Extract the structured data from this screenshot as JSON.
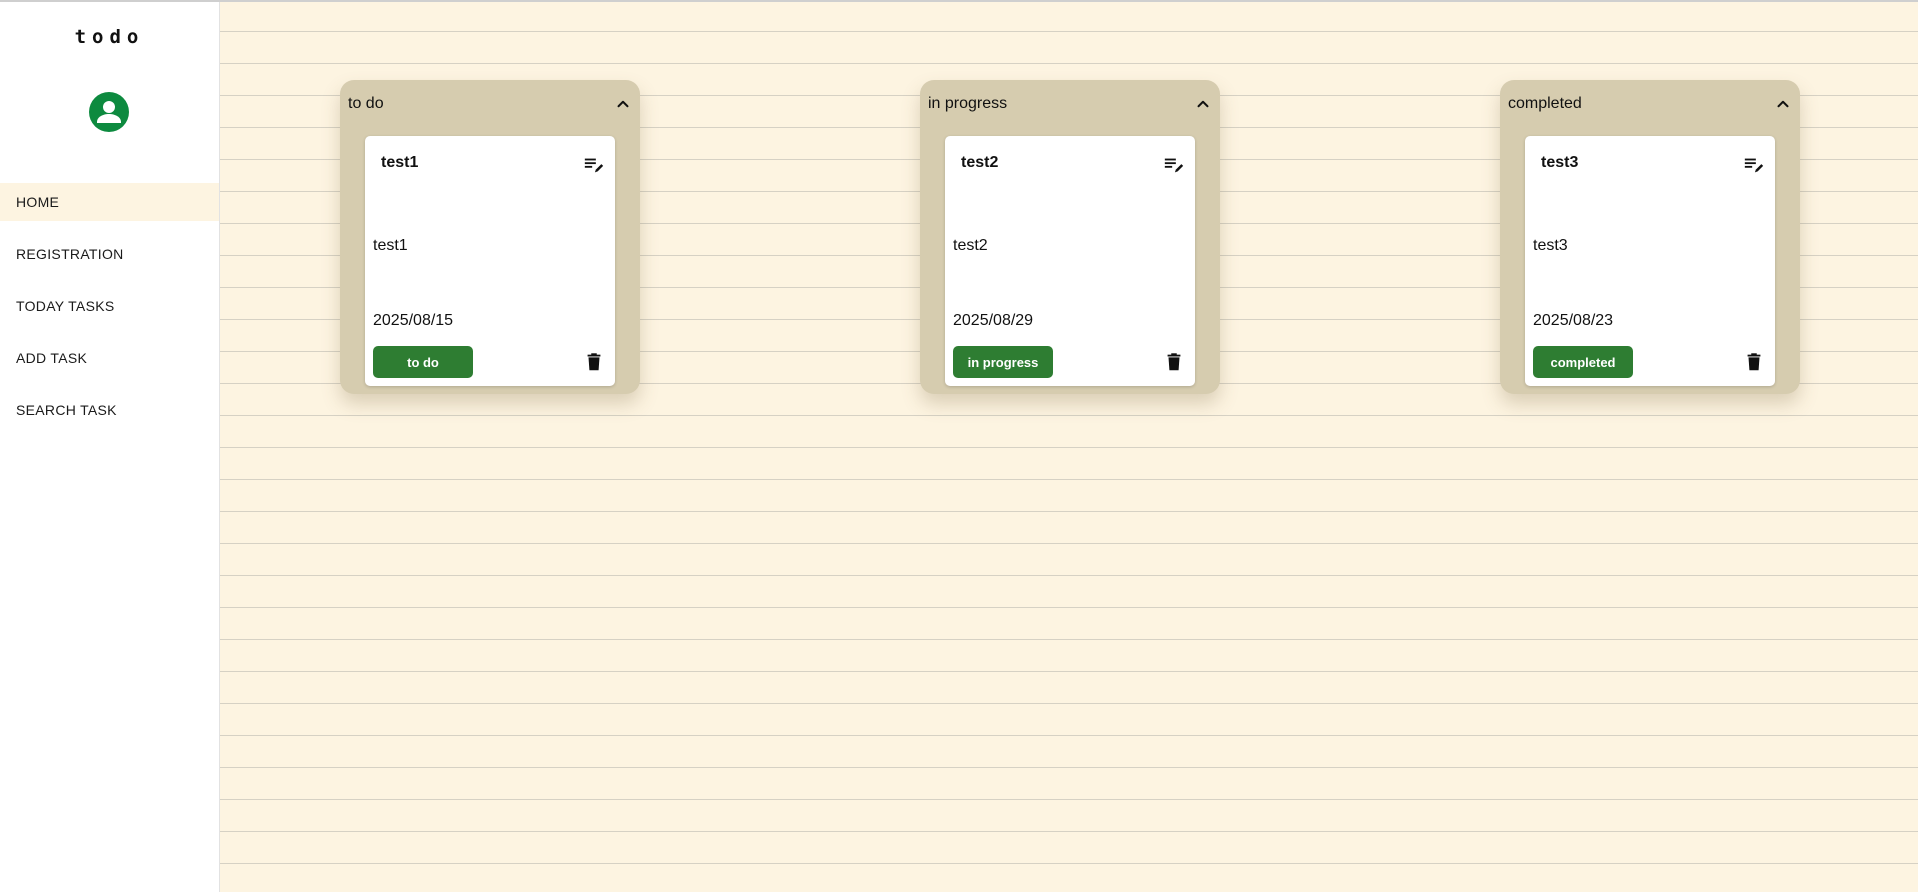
{
  "app": {
    "title": "todo"
  },
  "sidebar": {
    "avatar_icon": "account-circle-icon",
    "items": [
      {
        "label": "HOME",
        "active": true
      },
      {
        "label": "REGISTRATION"
      },
      {
        "label": "TODAY TASKS"
      },
      {
        "label": "ADD TASK"
      },
      {
        "label": "SEARCH TASK"
      }
    ]
  },
  "board": {
    "columns": [
      {
        "title": "to do",
        "collapse_icon": "chevron-up-icon",
        "cards": [
          {
            "title": "test1",
            "description": "test1",
            "date": "2025/08/15",
            "status": "to do"
          }
        ]
      },
      {
        "title": "in progress",
        "collapse_icon": "chevron-up-icon",
        "cards": [
          {
            "title": "test2",
            "description": "test2",
            "date": "2025/08/29",
            "status": "in progress"
          }
        ]
      },
      {
        "title": "completed",
        "collapse_icon": "chevron-up-icon",
        "cards": [
          {
            "title": "test3",
            "description": "test3",
            "date": "2025/08/23",
            "status": "completed"
          }
        ]
      }
    ]
  },
  "colors": {
    "background": "#fdf4e1",
    "column": "#d6ccaf",
    "status_button": "#2e7d32",
    "avatar": "#0d8a3f"
  }
}
